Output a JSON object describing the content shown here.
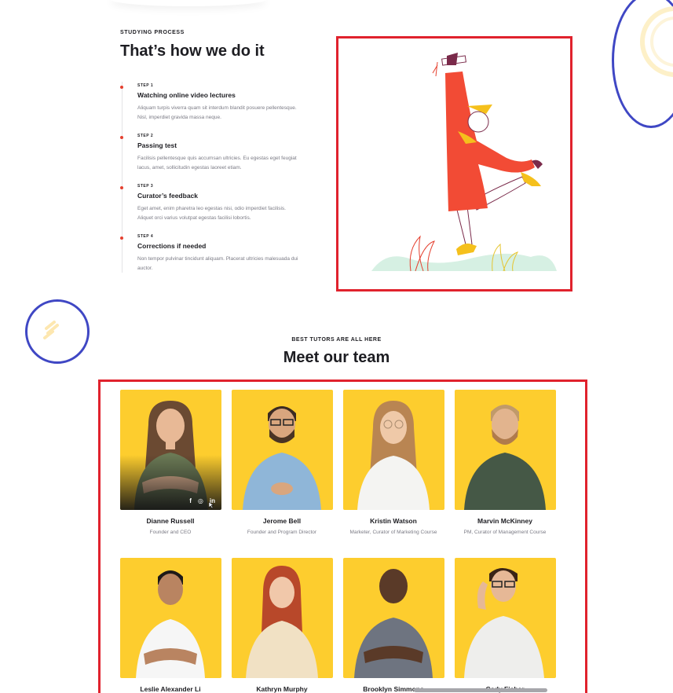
{
  "process": {
    "eyebrow": "STUDYING PROCESS",
    "title": "That’s how we do it",
    "steps": [
      {
        "label": "STEP 1",
        "title": "Watching online video lectures",
        "desc": "Aliquam turpis viverra quam sit interdum blandit posuere pellentesque. Nisl, imperdiet gravida massa neque."
      },
      {
        "label": "STEP 2",
        "title": "Passing test",
        "desc": "Facilisis pellentesque quis accumsan ultricies. Eu egestas eget feugiat lacus, amet, sollicitudin egestas laoreet etiam."
      },
      {
        "label": "STEP 3",
        "title": "Curator’s feedback",
        "desc": "Eget amet, enim pharetra leo egestas nisi, odio imperdiet facilisis. Aliquet orci varius volutpat egestas facilisi lobortis."
      },
      {
        "label": "STEP 4",
        "title": "Corrections if needed",
        "desc": "Non tempor pulvinar tincidunt aliquam. Placerat ultricies malesuada dui auctor."
      }
    ]
  },
  "team": {
    "eyebrow": "BEST TUTORS ARE ALL HERE",
    "title": "Meet our team",
    "members": [
      {
        "name": "Dianne Russell",
        "role": "Founder and CEO"
      },
      {
        "name": "Jerome Bell",
        "role": "Founder and Program Director"
      },
      {
        "name": "Kristin Watson",
        "role": "Marketer, Curator of Marketing Course"
      },
      {
        "name": "Marvin McKinney",
        "role": "PM, Curator of Management Course"
      },
      {
        "name": "Leslie Alexander Li",
        "role": ""
      },
      {
        "name": "Kathryn Murphy",
        "role": ""
      },
      {
        "name": "Brooklyn Simmons",
        "role": ""
      },
      {
        "name": "Cody Fisher",
        "role": ""
      }
    ],
    "socials": {
      "facebook": "f",
      "instagram": "◎",
      "linkedin": "in"
    }
  },
  "colors": {
    "accent": "#e5402f",
    "photo_bg": "#fdcd2e",
    "highlight_border": "#e0222d",
    "circle_annotation": "#3f47c4"
  },
  "icons": [
    "facebook-icon",
    "instagram-icon",
    "linkedin-icon",
    "cursor-icon",
    "arrows-decoration-icon",
    "graduate-illustration"
  ]
}
